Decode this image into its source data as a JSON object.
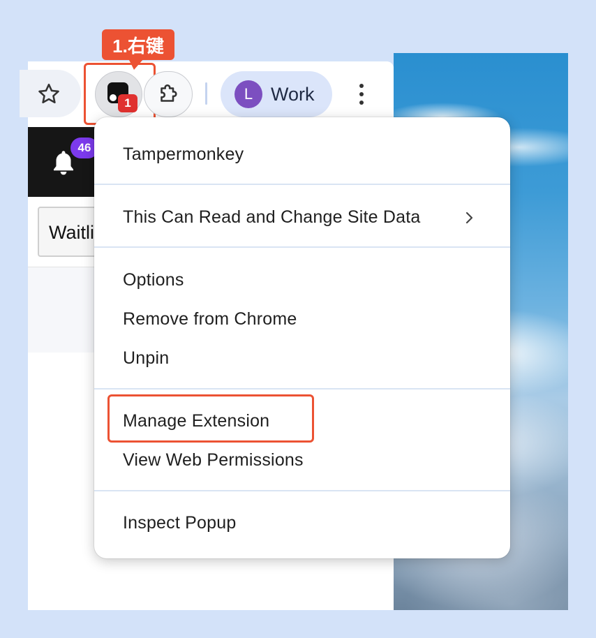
{
  "annotation": {
    "step_label": "1.右键"
  },
  "toolbar": {
    "extension_badge": "1",
    "profile_initial": "L",
    "profile_name": "Work"
  },
  "page": {
    "notification_count": "46",
    "waitlist_button_text": "Waitli"
  },
  "context_menu": {
    "items": [
      {
        "label": "Tampermonkey"
      },
      {
        "label": "This Can Read and Change Site Data"
      },
      {
        "label": "Options"
      },
      {
        "label": "Remove from Chrome"
      },
      {
        "label": "Unpin"
      },
      {
        "label": "Manage Extension"
      },
      {
        "label": "View Web Permissions"
      },
      {
        "label": "Inspect Popup"
      }
    ]
  },
  "colors": {
    "annotation": "#ec5233",
    "badge": "#e0312f",
    "avatar": "#7c4fc0",
    "notification_badge": "#7c3aed",
    "background": "#d3e2f9"
  }
}
